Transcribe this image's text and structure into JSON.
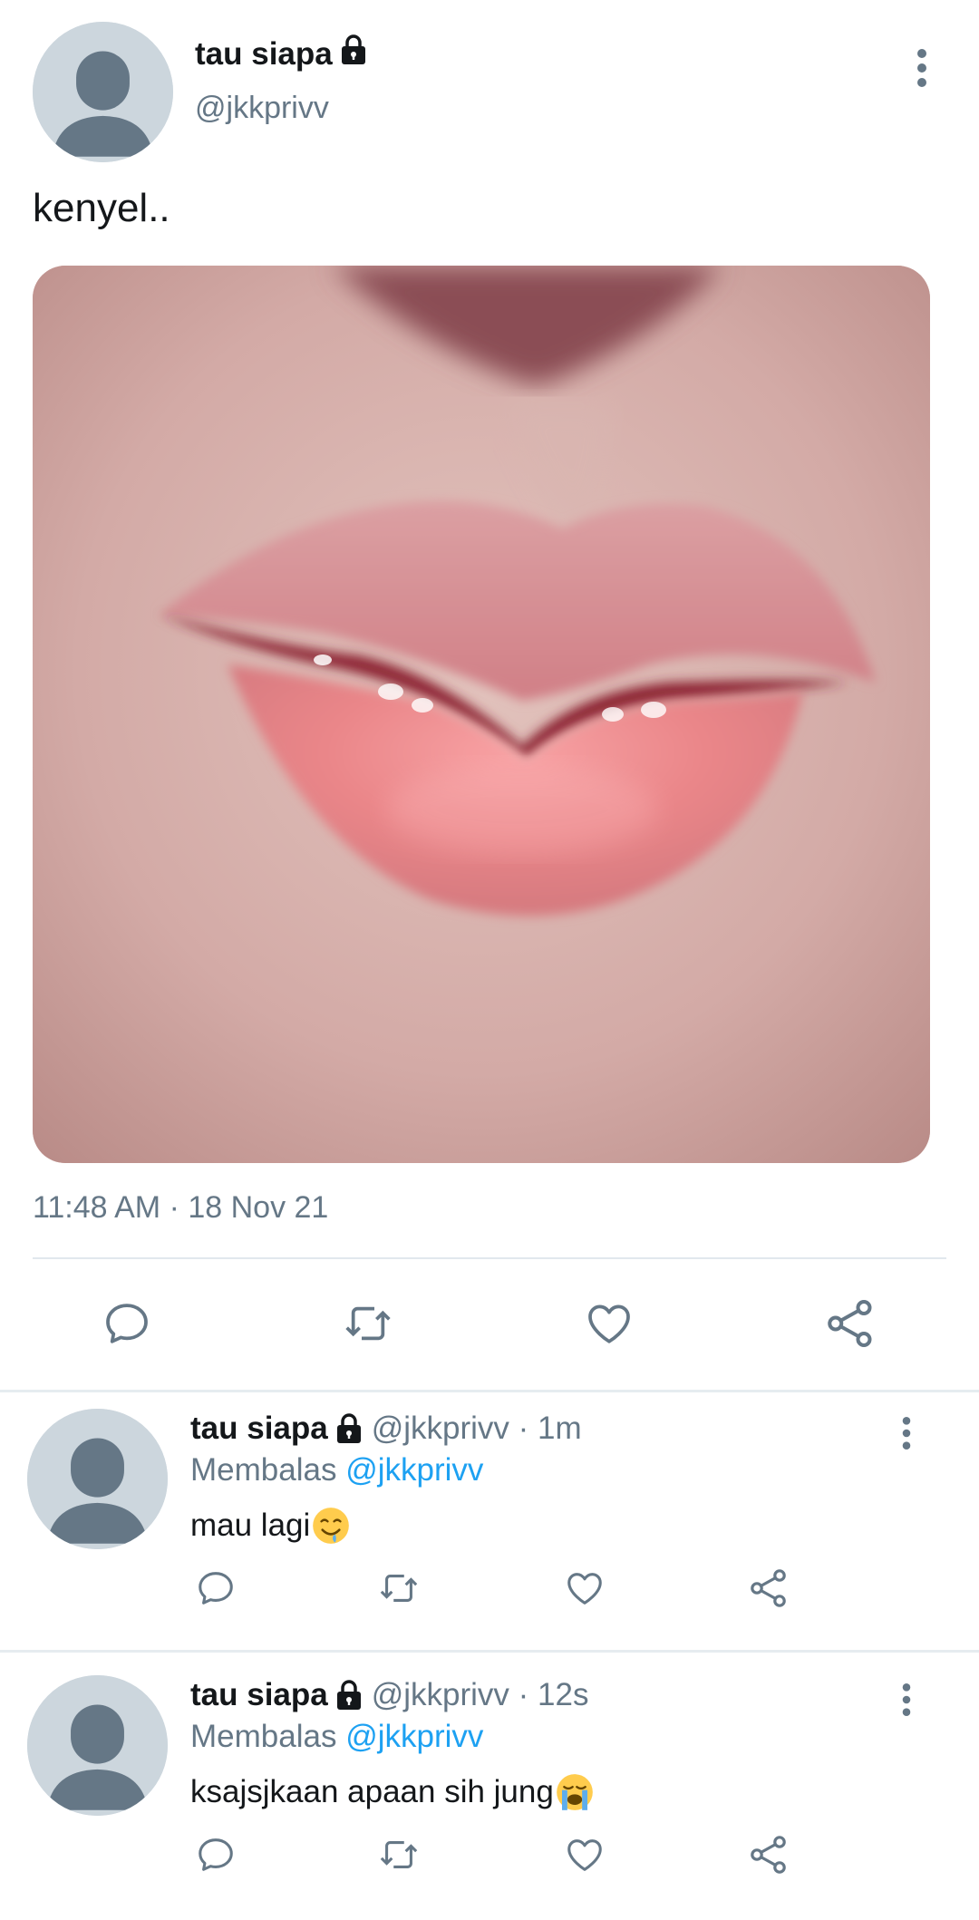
{
  "main_tweet": {
    "display_name": "tau siapa",
    "handle": "@jkkprivv",
    "text": "kenyel..",
    "timestamp": "11:48 AM · 18 Nov 21",
    "icons": {
      "avatar": "default-avatar-icon",
      "lock": "lock-icon",
      "more": "more-vertical-icon",
      "reply": "reply-icon",
      "retweet": "retweet-icon",
      "like": "like-icon",
      "share": "share-icon"
    }
  },
  "replies": [
    {
      "display_name": "tau siapa",
      "handle_time": "@jkkprivv · 1m",
      "replying_label": "Membalas",
      "replying_to": "@jkkprivv",
      "text": "mau lagi",
      "emoji": "drooling-face-emoji"
    },
    {
      "display_name": "tau siapa",
      "handle_time": "@jkkprivv · 12s",
      "replying_label": "Membalas",
      "replying_to": "@jkkprivv",
      "text": "ksajsjkaan apaan sih jung",
      "emoji": "loudly-crying-face-emoji"
    }
  ],
  "colors": {
    "text_primary": "#14171a",
    "text_secondary": "#657786",
    "accent": "#1da1f2",
    "divider": "#e1e8ed",
    "avatar_bg": "#ccd6dd",
    "avatar_fg": "#657786"
  }
}
